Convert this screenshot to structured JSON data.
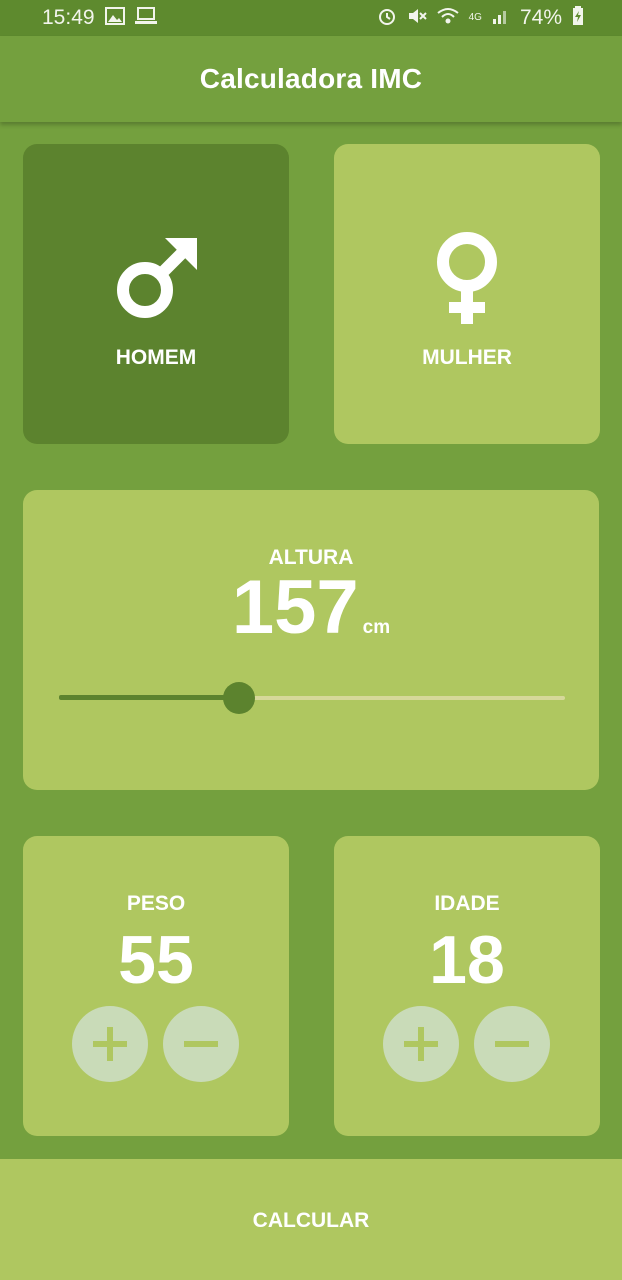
{
  "status_bar": {
    "time": "15:49",
    "battery": "74%",
    "network": "4G",
    "icons_left": [
      "image-icon",
      "laptop-icon"
    ],
    "icons_right": [
      "alarm-icon",
      "mute-icon",
      "wifi-icon",
      "signal-icon",
      "battery-charging-icon"
    ]
  },
  "app_bar": {
    "title": "Calculadora IMC"
  },
  "gender": {
    "male": {
      "label": "HOMEM",
      "icon": "male-symbol-icon",
      "selected": true
    },
    "female": {
      "label": "MULHER",
      "icon": "female-symbol-icon",
      "selected": false
    }
  },
  "height": {
    "label": "ALTURA",
    "value": "157",
    "unit": "cm",
    "slider_fraction": 0.355
  },
  "weight": {
    "label": "PESO",
    "value": "55"
  },
  "age": {
    "label": "IDADE",
    "value": "18"
  },
  "calculate": {
    "label": "CALCULAR"
  },
  "colors": {
    "background": "#74a03e",
    "card_active": "#5c832e",
    "card_inactive": "#afc760",
    "button_circle": "#c9dbb8",
    "slider_inactive": "#d6d89a"
  }
}
